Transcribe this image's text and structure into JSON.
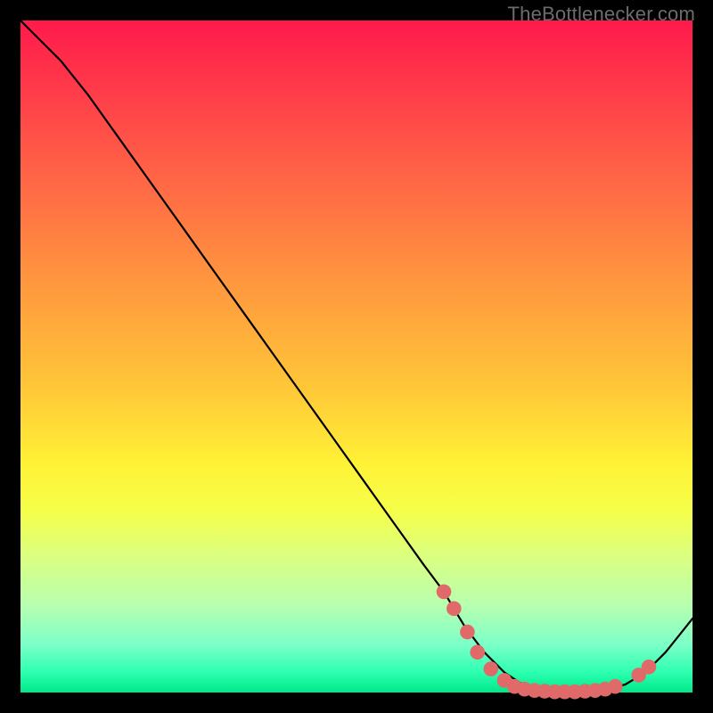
{
  "watermark": "TheBottlenecker.com",
  "chart_data": {
    "type": "line",
    "title": "",
    "xlabel": "",
    "ylabel": "",
    "xlim": [
      0,
      100
    ],
    "ylim": [
      0,
      100
    ],
    "grid": false,
    "series": [
      {
        "name": "curve",
        "color": "#000000",
        "x": [
          0,
          3,
          6,
          10,
          15,
          20,
          25,
          30,
          35,
          40,
          45,
          50,
          55,
          60,
          63,
          66,
          69,
          72,
          75,
          78,
          81,
          84,
          87,
          90,
          93,
          96,
          100
        ],
        "y": [
          100,
          97,
          94,
          89,
          82,
          75,
          68,
          61,
          54,
          47,
          40,
          33,
          26,
          19,
          15,
          10,
          6,
          3,
          1,
          0.3,
          0,
          0,
          0.4,
          1.2,
          3,
          6,
          11
        ]
      }
    ],
    "markers": {
      "name": "dots",
      "color": "#e06a6a",
      "radius_pct": 1.1,
      "points": [
        {
          "x": 63.0,
          "y": 15.0
        },
        {
          "x": 64.5,
          "y": 12.5
        },
        {
          "x": 66.5,
          "y": 9.0
        },
        {
          "x": 68.0,
          "y": 6.0
        },
        {
          "x": 70.0,
          "y": 3.5
        },
        {
          "x": 72.0,
          "y": 1.8
        },
        {
          "x": 73.5,
          "y": 0.9
        },
        {
          "x": 75.0,
          "y": 0.5
        },
        {
          "x": 76.5,
          "y": 0.3
        },
        {
          "x": 78.0,
          "y": 0.2
        },
        {
          "x": 79.5,
          "y": 0.1
        },
        {
          "x": 81.0,
          "y": 0.1
        },
        {
          "x": 82.5,
          "y": 0.1
        },
        {
          "x": 84.0,
          "y": 0.2
        },
        {
          "x": 85.5,
          "y": 0.3
        },
        {
          "x": 87.0,
          "y": 0.5
        },
        {
          "x": 88.5,
          "y": 0.9
        },
        {
          "x": 92.0,
          "y": 2.6
        },
        {
          "x": 93.5,
          "y": 3.8
        }
      ]
    }
  }
}
